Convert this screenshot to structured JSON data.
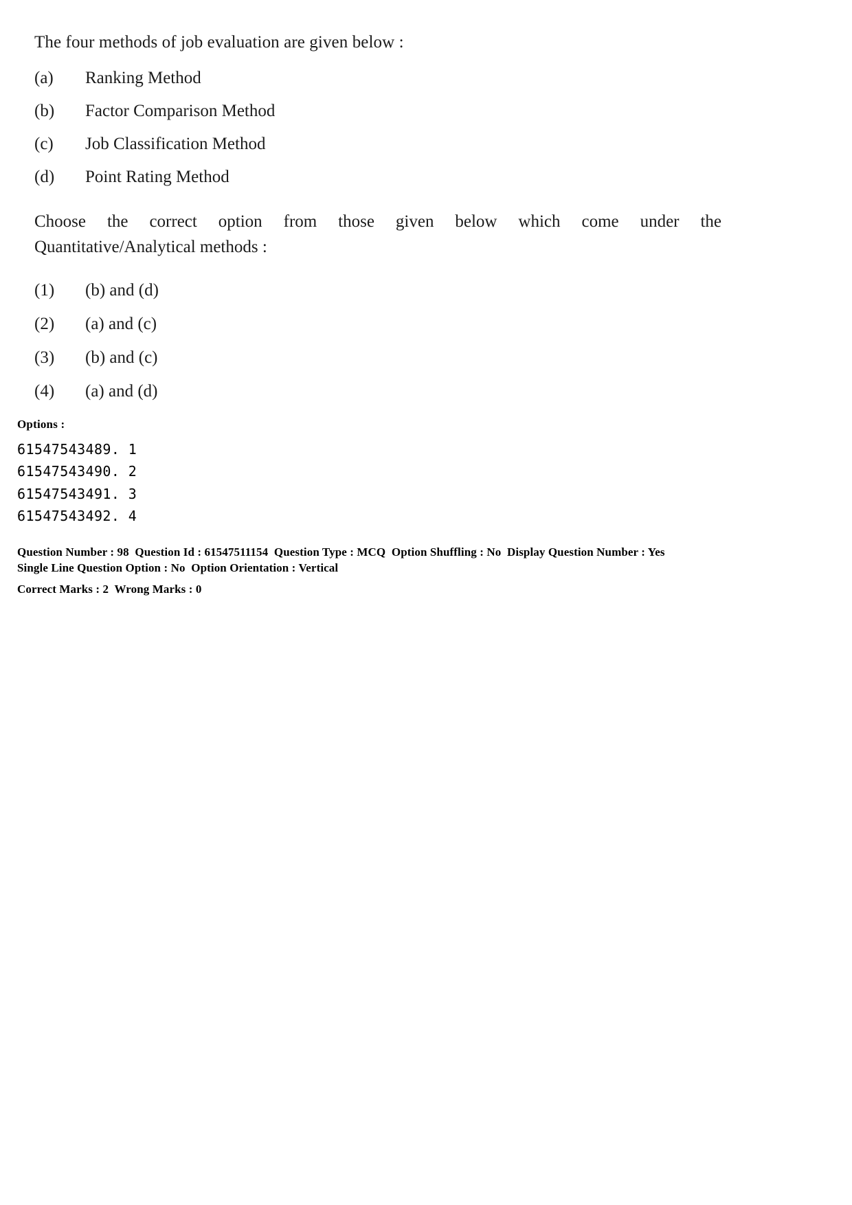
{
  "question": {
    "stem": "The four methods of job evaluation are given below :",
    "methods": [
      {
        "label": "(a)",
        "text": "Ranking Method"
      },
      {
        "label": "(b)",
        "text": "Factor Comparison Method"
      },
      {
        "label": "(c)",
        "text": "Job Classification Method"
      },
      {
        "label": "(d)",
        "text": "Point Rating Method"
      }
    ],
    "instruction_line1": "Choose the correct option from those given below which come under the",
    "instruction_line2": "Quantitative/Analytical methods :",
    "choices": [
      {
        "num": "(1)",
        "text": "(b) and (d)"
      },
      {
        "num": "(2)",
        "text": "(a) and (c)"
      },
      {
        "num": "(3)",
        "text": "(b) and (c)"
      },
      {
        "num": "(4)",
        "text": "(a) and (d)"
      }
    ]
  },
  "options_block": {
    "heading": "Options :",
    "ids": [
      "61547543489. 1",
      "61547543490. 2",
      "61547543491. 3",
      "61547543492. 4"
    ]
  },
  "metadata": {
    "line1": "Question Number : 98  Question Id : 61547511154  Question Type : MCQ  Option Shuffling : No  Display Question Number : Yes",
    "line2": "Single Line Question Option : No  Option Orientation : Vertical",
    "line3": "Correct Marks : 2  Wrong Marks : 0"
  }
}
